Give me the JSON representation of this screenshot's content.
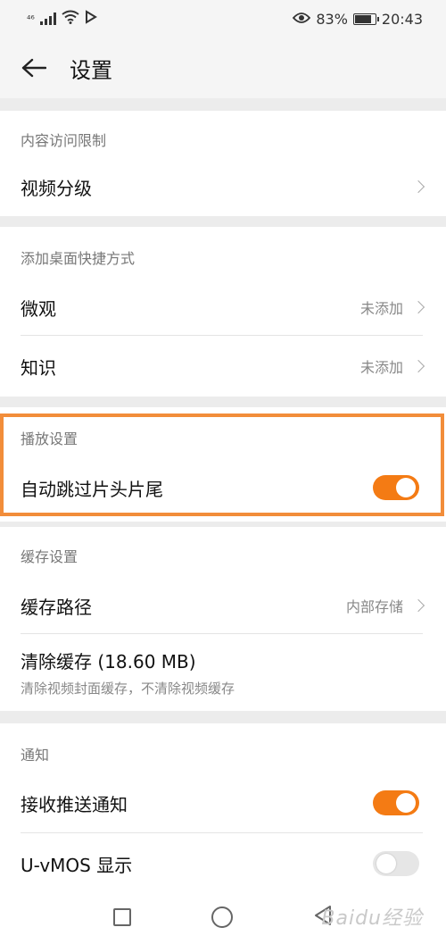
{
  "status_bar": {
    "signal_text": "⁴⁶",
    "battery": "83%",
    "time": "20:43",
    "battery_level": 0.83
  },
  "header": {
    "title": "设置"
  },
  "sections": {
    "content": {
      "heading": "内容访问限制",
      "items": [
        {
          "label": "视频分级",
          "value": ""
        }
      ]
    },
    "shortcut": {
      "heading": "添加桌面快捷方式",
      "items": [
        {
          "label": "微观",
          "value": "未添加"
        },
        {
          "label": "知识",
          "value": "未添加"
        }
      ]
    },
    "playback": {
      "heading": "播放设置",
      "items": [
        {
          "label": "自动跳过片头片尾",
          "toggle": true
        }
      ]
    },
    "cache": {
      "heading": "缓存设置",
      "items": [
        {
          "label": "缓存路径",
          "value": "内部存储"
        },
        {
          "label": "清除缓存 (18.60 MB)",
          "sub": "清除视频封面缓存，不清除视频缓存"
        }
      ]
    },
    "notify": {
      "heading": "通知",
      "items": [
        {
          "label": "接收推送通知",
          "toggle": true
        },
        {
          "label": "U-vMOS 显示",
          "toggle": false
        }
      ]
    }
  },
  "watermark": "Baidu经验",
  "colors": {
    "accent": "#f47b14",
    "highlight": "#f28d3a"
  }
}
